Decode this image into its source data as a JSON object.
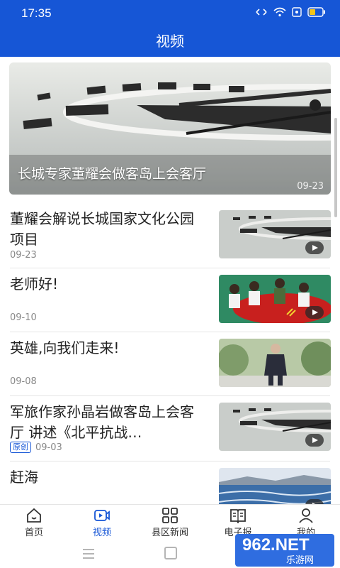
{
  "status": {
    "time": "17:35"
  },
  "header": {
    "title": "视频"
  },
  "hero": {
    "title": "长城专家董耀会做客岛上会客厅",
    "date": "09-23"
  },
  "items": [
    {
      "title": "董耀会解说长城国家文化公园项目",
      "date": "09-23",
      "badge": ""
    },
    {
      "title": "老师好!",
      "date": "09-10",
      "badge": ""
    },
    {
      "title": "英雄,向我们走来!",
      "date": "09-08",
      "badge": ""
    },
    {
      "title": "军旅作家孙晶岩做客岛上会客厅 讲述《北平抗战…",
      "date": "09-03",
      "badge": "原创"
    },
    {
      "title": "赶海",
      "date": "",
      "badge": ""
    }
  ],
  "tabs": [
    {
      "label": "首页",
      "icon": "home-icon",
      "active": false
    },
    {
      "label": "视频",
      "icon": "video-icon",
      "active": true
    },
    {
      "label": "县区新闻",
      "icon": "grid-icon",
      "active": false
    },
    {
      "label": "电子报",
      "icon": "book-icon",
      "active": false
    },
    {
      "label": "我的",
      "icon": "user-icon",
      "active": false
    }
  ],
  "watermark": {
    "brand": "962.NET",
    "site": "乐游网"
  },
  "colors": {
    "primary": "#1656d6"
  }
}
